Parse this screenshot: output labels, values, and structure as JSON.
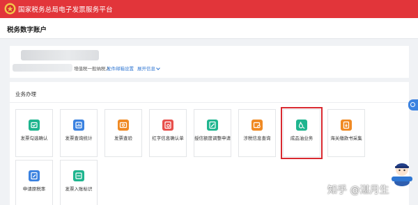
{
  "header": {
    "title": "国家税务总局电子发票服务平台",
    "brand_color": "#e2353a"
  },
  "page": {
    "title": "税务数字账户"
  },
  "user": {
    "taxpayer_type": "增值税一般纳税人",
    "email_link": "发件邮箱设置",
    "expand_link": "展开信息"
  },
  "business": {
    "section_title": "业务办理",
    "tiles": [
      {
        "label": "发票勾选确认",
        "icon": "check-ticket-icon",
        "color": "#1fb58f"
      },
      {
        "label": "发票查询统计",
        "icon": "query-stats-icon",
        "color": "#3b82e0"
      },
      {
        "label": "发票查验",
        "icon": "verify-ticket-icon",
        "color": "#f08a24"
      },
      {
        "label": "红字信息确认单",
        "icon": "red-invoice-icon",
        "color": "#e8504c"
      },
      {
        "label": "授信额度调整申请",
        "icon": "credit-adjust-icon",
        "color": "#1fb58f"
      },
      {
        "label": "涉税信息查询",
        "icon": "tax-info-icon",
        "color": "#f08a24"
      },
      {
        "label": "成品油业务",
        "icon": "oil-drop-icon",
        "color": "#1fb58f",
        "highlighted": true
      },
      {
        "label": "海关缴款书采集",
        "icon": "customs-doc-icon",
        "color": "#f08a24"
      },
      {
        "label": "申请原税率",
        "icon": "apply-rate-icon",
        "color": "#3b82e0"
      },
      {
        "label": "发票入账标识",
        "icon": "ledger-mark-icon",
        "color": "#1fb58f"
      }
    ]
  },
  "watermark": "知乎 @湛月生"
}
